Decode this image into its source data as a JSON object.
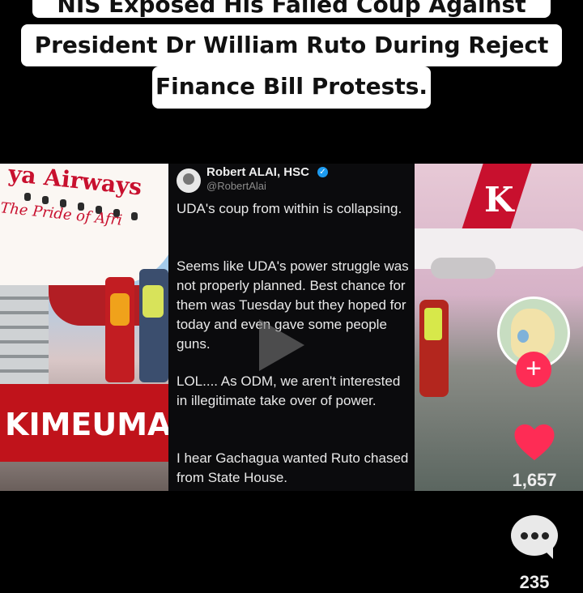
{
  "headline": {
    "line1": "NIS Exposed His Failed Coup Against",
    "line2": "President Dr William Ruto During Reject",
    "line3": "Finance Bill Protests."
  },
  "left_panel": {
    "airline_text": "ya Airways",
    "tagline": "The Pride of Afri",
    "banner": "KIMEUMA"
  },
  "tweet": {
    "name": "Robert ALAI, HSC",
    "handle": "@RobertAlai",
    "paragraphs": [
      "UDA's coup from within is collapsing.",
      "Seems like UDA's power struggle was not properly planned. Best chance for them was Tuesday but they hoped for today and even gave some people guns.",
      "LOL.... As ODM, we aren't interested in illegitimate take over of power.",
      "I hear Gachagua wanted Ruto chased from State House."
    ]
  },
  "right_panel": {
    "tail_logo": "K"
  },
  "sidebar": {
    "follow_symbol": "+",
    "likes": "1,657",
    "comments": "235",
    "like_color": "#fe2c55"
  }
}
